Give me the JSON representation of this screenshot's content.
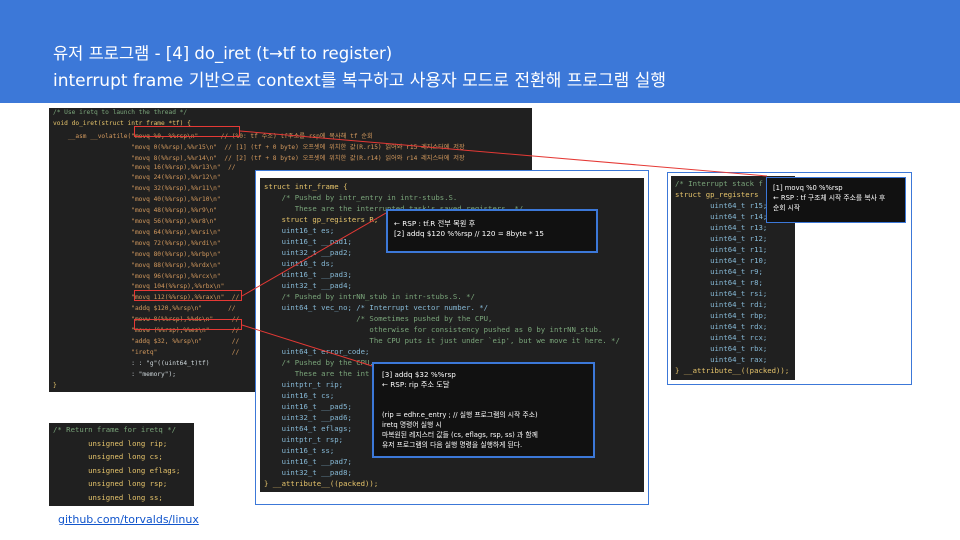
{
  "slide": {
    "title_line1": "유저 프로그램 - [4] do_iret  (t→tf to register)",
    "title_line2": "interrupt frame 기반으로 context를 복구하고 사용자 모드로 전환해 프로그램 실행",
    "footer_link": "github.com/torvalds/linux"
  },
  "do_iret_code": [
    {
      "t": "/* Use iretq to launch the thread */",
      "c": "cm"
    },
    {
      "t": "void do_iret(struct intr_frame *tf) {",
      "c": "kw"
    },
    {
      "t": "    __asm __volatile(\"movq %0, %%rsp\\n\"      // (%0: tf 주소) tf주소를 rsp에 복사해 tf 순회",
      "c": "st"
    },
    {
      "t": "                     \"movq 0(%%rsp),%%r15\\n\"  // [1] (tf + 0 byte) 오프셋에 위치한 값(R.r15) 읽어와 r15 레지스터에 저장",
      "c": "st"
    },
    {
      "t": "                     \"movq 8(%%rsp),%%r14\\n\"  // [2] (tf + 8 byte) 오프셋에 위치한 값(R.r14) 읽어와 r14 레지스터에 저장",
      "c": "st"
    },
    {
      "t": "                     \"movq 16(%%rsp),%%r13\\n\"  //",
      "c": "st"
    },
    {
      "t": "                     \"movq 24(%%rsp),%%r12\\n\"",
      "c": "st"
    },
    {
      "t": "                     \"movq 32(%%rsp),%%r11\\n\"",
      "c": "st"
    },
    {
      "t": "                     \"movq 40(%%rsp),%%r10\\n\"",
      "c": "st"
    },
    {
      "t": "                     \"movq 48(%%rsp),%%r9\\n\"",
      "c": "st"
    },
    {
      "t": "                     \"movq 56(%%rsp),%%r8\\n\"",
      "c": "st"
    },
    {
      "t": "                     \"movq 64(%%rsp),%%rsi\\n\"",
      "c": "st"
    },
    {
      "t": "                     \"movq 72(%%rsp),%%rdi\\n\"",
      "c": "st"
    },
    {
      "t": "                     \"movq 80(%%rsp),%%rbp\\n\"",
      "c": "st"
    },
    {
      "t": "                     \"movq 88(%%rsp),%%rdx\\n\"",
      "c": "st"
    },
    {
      "t": "                     \"movq 96(%%rsp),%%rcx\\n\"",
      "c": "st"
    },
    {
      "t": "                     \"movq 104(%%rsp),%%rbx\\n\"",
      "c": "st"
    },
    {
      "t": "                     \"movq 112(%%rsp),%%rax\\n\"  //",
      "c": "st"
    },
    {
      "t": "                     \"addq $120,%%rsp\\n\"       //",
      "c": "st"
    },
    {
      "t": "                     \"movw 8(%%rsp),%%ds\\n\"     //",
      "c": "st"
    },
    {
      "t": "                     \"movw (%%rsp),%%es\\n\"      //",
      "c": "st"
    },
    {
      "t": "                     \"addq $32, %%rsp\\n\"        //",
      "c": "st"
    },
    {
      "t": "                     \"iretq\"                    //",
      "c": "st"
    },
    {
      "t": "                     : : \"g\"((uint64_t)tf)",
      "c": "wh"
    },
    {
      "t": "                     : \"memory\");",
      "c": "wh"
    },
    {
      "t": "}",
      "c": "kw"
    }
  ],
  "return_frame_code": [
    {
      "t": "/* Return frame for iretq */",
      "c": "cm"
    },
    {
      "t": "        unsigned long rip;",
      "c": "kw"
    },
    {
      "t": "        unsigned long cs;",
      "c": "kw"
    },
    {
      "t": "        unsigned long eflags;",
      "c": "kw"
    },
    {
      "t": "        unsigned long rsp;",
      "c": "kw"
    },
    {
      "t": "        unsigned long ss;",
      "c": "kw"
    }
  ],
  "intr_frame_code": [
    {
      "t": "struct intr_frame {",
      "c": "kw"
    },
    {
      "t": "    /* Pushed by intr_entry in intr-stubs.S.",
      "c": "cm"
    },
    {
      "t": "       These are the interrupted task's saved registers. */",
      "c": "cm"
    },
    {
      "t": "    struct gp_registers R;",
      "c": "kw"
    },
    {
      "t": "    uint16_t es;",
      "c": "ty"
    },
    {
      "t": "    uint16_t __pad1;",
      "c": "ty"
    },
    {
      "t": "    uint32_t __pad2;",
      "c": "ty"
    },
    {
      "t": "    uint16_t ds;",
      "c": "ty"
    },
    {
      "t": "    uint16_t __pad3;",
      "c": "ty"
    },
    {
      "t": "    uint32_t __pad4;",
      "c": "ty"
    },
    {
      "t": "    /* Pushed by intrNN_stub in intr-stubs.S. */",
      "c": "cm"
    },
    {
      "t": "    uint64_t vec_no; /* Interrupt vector number. */",
      "c": "ty"
    },
    {
      "t": "                     /* Sometimes pushed by the CPU,",
      "c": "cm"
    },
    {
      "t": "                        otherwise for consistency pushed as 0 by intrNN_stub.",
      "c": "cm"
    },
    {
      "t": "                        The CPU puts it just under `eip', but we move it here. */",
      "c": "cm"
    },
    {
      "t": "    uint64_t error_code;",
      "c": "ty"
    },
    {
      "t": "    /* Pushed by the CPU.",
      "c": "cm"
    },
    {
      "t": "       These are the int",
      "c": "cm"
    },
    {
      "t": "    uintptr_t rip;",
      "c": "ty"
    },
    {
      "t": "    uint16_t cs;",
      "c": "ty"
    },
    {
      "t": "    uint16_t __pad5;",
      "c": "ty"
    },
    {
      "t": "    uint32_t __pad6;",
      "c": "ty"
    },
    {
      "t": "    uint64_t eflags;",
      "c": "ty"
    },
    {
      "t": "    uintptr_t rsp;",
      "c": "ty"
    },
    {
      "t": "    uint16_t ss;",
      "c": "ty"
    },
    {
      "t": "    uint16_t __pad7;",
      "c": "ty"
    },
    {
      "t": "    uint32_t __pad8;",
      "c": "ty"
    },
    {
      "t": "} __attribute__((packed));",
      "c": "kw"
    }
  ],
  "gp_registers_code": [
    {
      "t": "/* Interrupt stack f",
      "c": "cm"
    },
    {
      "t": "struct gp_registers",
      "c": "kw"
    },
    {
      "t": "        uint64_t r15;",
      "c": "ty"
    },
    {
      "t": "        uint64_t r14;",
      "c": "ty"
    },
    {
      "t": "        uint64_t r13;",
      "c": "ty"
    },
    {
      "t": "        uint64_t r12;",
      "c": "ty"
    },
    {
      "t": "        uint64_t r11;",
      "c": "ty"
    },
    {
      "t": "        uint64_t r10;",
      "c": "ty"
    },
    {
      "t": "        uint64_t r9;",
      "c": "ty"
    },
    {
      "t": "        uint64_t r8;",
      "c": "ty"
    },
    {
      "t": "        uint64_t rsi;",
      "c": "ty"
    },
    {
      "t": "        uint64_t rdi;",
      "c": "ty"
    },
    {
      "t": "        uint64_t rbp;",
      "c": "ty"
    },
    {
      "t": "        uint64_t rdx;",
      "c": "ty"
    },
    {
      "t": "        uint64_t rcx;",
      "c": "ty"
    },
    {
      "t": "        uint64_t rbx;",
      "c": "ty"
    },
    {
      "t": "        uint64_t rax;",
      "c": "ty"
    },
    {
      "t": "} __attribute__((packed));",
      "c": "kw"
    }
  ],
  "notes": {
    "note1": "[1] movq %0 %%rsp\n← RSP : tf 구조체 시작 주소를 복사 후\n순회 시작",
    "note2": "← RSP : tf.R 전부 복원 후\n[2] addq $120 %%rsp // 120 = 8byte * 15",
    "note3a": "[3] addq $32 %%rsp\n← RSP: rip 주소 도달",
    "note3b": "(rip = edhr.e_entry ; // 실행 프로그램의 시작 주소)\niretq 명령어 실행 시\n마복원된 레지스터 값들 (cs, eflags, rsp, ss) 과 함께\n유저 프로그램의 다음 실행 명령을 실행하게 된다."
  }
}
